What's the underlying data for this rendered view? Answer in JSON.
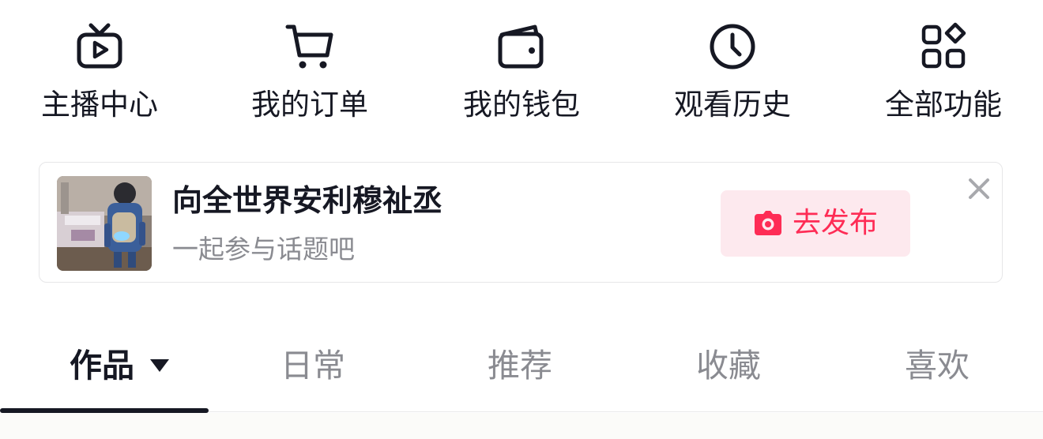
{
  "quick_actions": [
    {
      "icon": "live-tv-icon",
      "label": "主播中心"
    },
    {
      "icon": "cart-icon",
      "label": "我的订单"
    },
    {
      "icon": "wallet-icon",
      "label": "我的钱包"
    },
    {
      "icon": "clock-icon",
      "label": "观看历史"
    },
    {
      "icon": "apps-grid-icon",
      "label": "全部功能"
    }
  ],
  "topic_card": {
    "title": "向全世界安利穆祉丞",
    "subtitle": "一起参与话题吧",
    "publish_label": "去发布",
    "publish_icon": "camera-icon",
    "close_icon": "close-icon",
    "accent_color": "#fe2c55",
    "button_bg": "#fde9ee"
  },
  "tabs": {
    "items": [
      "作品",
      "日常",
      "推荐",
      "收藏",
      "喜欢"
    ],
    "active_index": 0,
    "active_dropdown_icon": "triangle-down-icon"
  },
  "colors": {
    "text_primary": "#161823",
    "text_secondary": "#8a8b91",
    "border": "#e6e6e8"
  }
}
